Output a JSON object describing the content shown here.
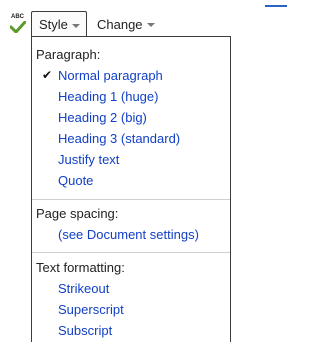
{
  "toolbar": {
    "spellcheck_badge": "ABC",
    "style_label": "Style",
    "change_label": "Change"
  },
  "menu": {
    "paragraph_header": "Paragraph:",
    "paragraph_items": [
      {
        "label": "Normal paragraph",
        "checked": true
      },
      {
        "label": "Heading 1 (huge)",
        "checked": false
      },
      {
        "label": "Heading 2 (big)",
        "checked": false
      },
      {
        "label": "Heading 3 (standard)",
        "checked": false
      },
      {
        "label": "Justify text",
        "checked": false
      },
      {
        "label": "Quote",
        "checked": false
      }
    ],
    "check_mark": "✔",
    "page_spacing_header": "Page spacing:",
    "page_spacing_item": "(see Document settings)",
    "text_formatting_header": "Text formatting:",
    "text_formatting_items": [
      "Strikeout",
      "Superscript",
      "Subscript"
    ]
  },
  "colors": {
    "link": "#1240c6",
    "accent": "#2a63c7",
    "check_green": "#5a9a2a"
  }
}
